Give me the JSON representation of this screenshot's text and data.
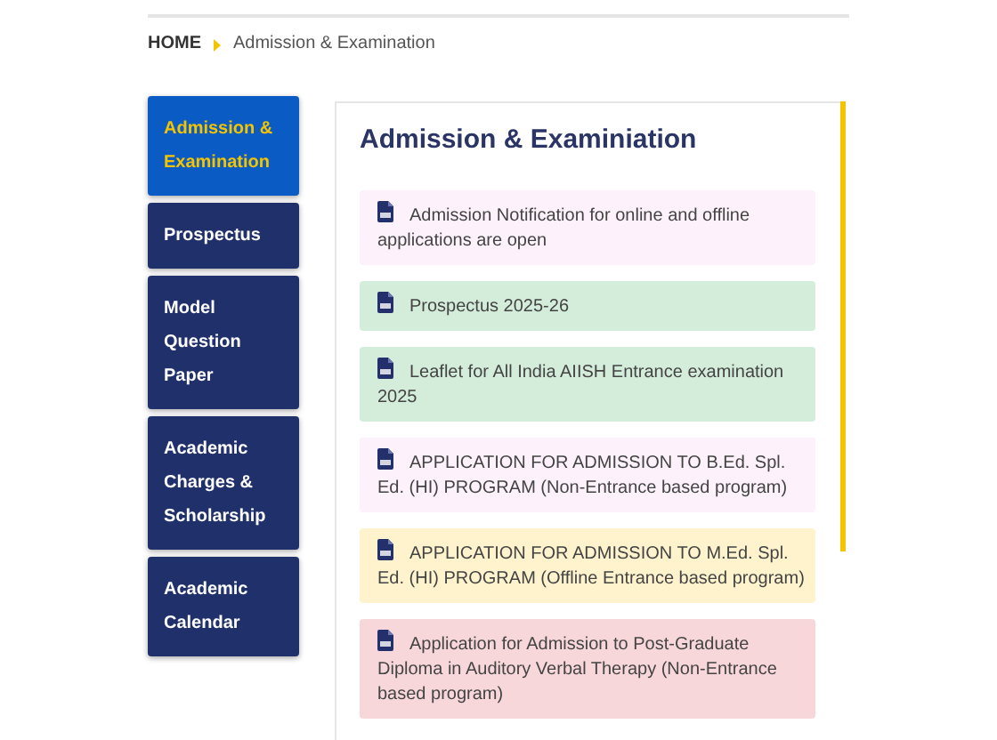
{
  "breadcrumb": {
    "home": "HOME",
    "current": "Admission & Examination"
  },
  "sidebar": {
    "items": [
      {
        "label": "Admission & Examination",
        "selected": true
      },
      {
        "label": "Prospectus",
        "selected": false
      },
      {
        "label": "Model Question Paper",
        "selected": false
      },
      {
        "label": "Academic Charges & Scholarship",
        "selected": false
      },
      {
        "label": "Academic Calendar",
        "selected": false
      }
    ]
  },
  "content": {
    "title": "Admission & Examiniation",
    "items": [
      {
        "text": "Admission Notification for online and offline applications are open",
        "color": "#fdf2fb"
      },
      {
        "text": "Prospectus 2025-26",
        "color": "#d4edda"
      },
      {
        "text": "Leaflet for All India AIISH Entrance examination 2025",
        "color": "#d4edda"
      },
      {
        "text": "APPLICATION FOR ADMISSION TO B.Ed. Spl. Ed. (HI) PROGRAM (Non-Entrance based program)",
        "color": "#fdf2fb"
      },
      {
        "text": "APPLICATION FOR ADMISSION TO M.Ed. Spl. Ed. (HI) PROGRAM (Offline Entrance based program)",
        "color": "#fff3cd"
      },
      {
        "text": "Application for Admission to Post-Graduate Diploma in Auditory Verbal Therapy (Non-Entrance based program)",
        "color": "#f8d7da"
      }
    ]
  }
}
